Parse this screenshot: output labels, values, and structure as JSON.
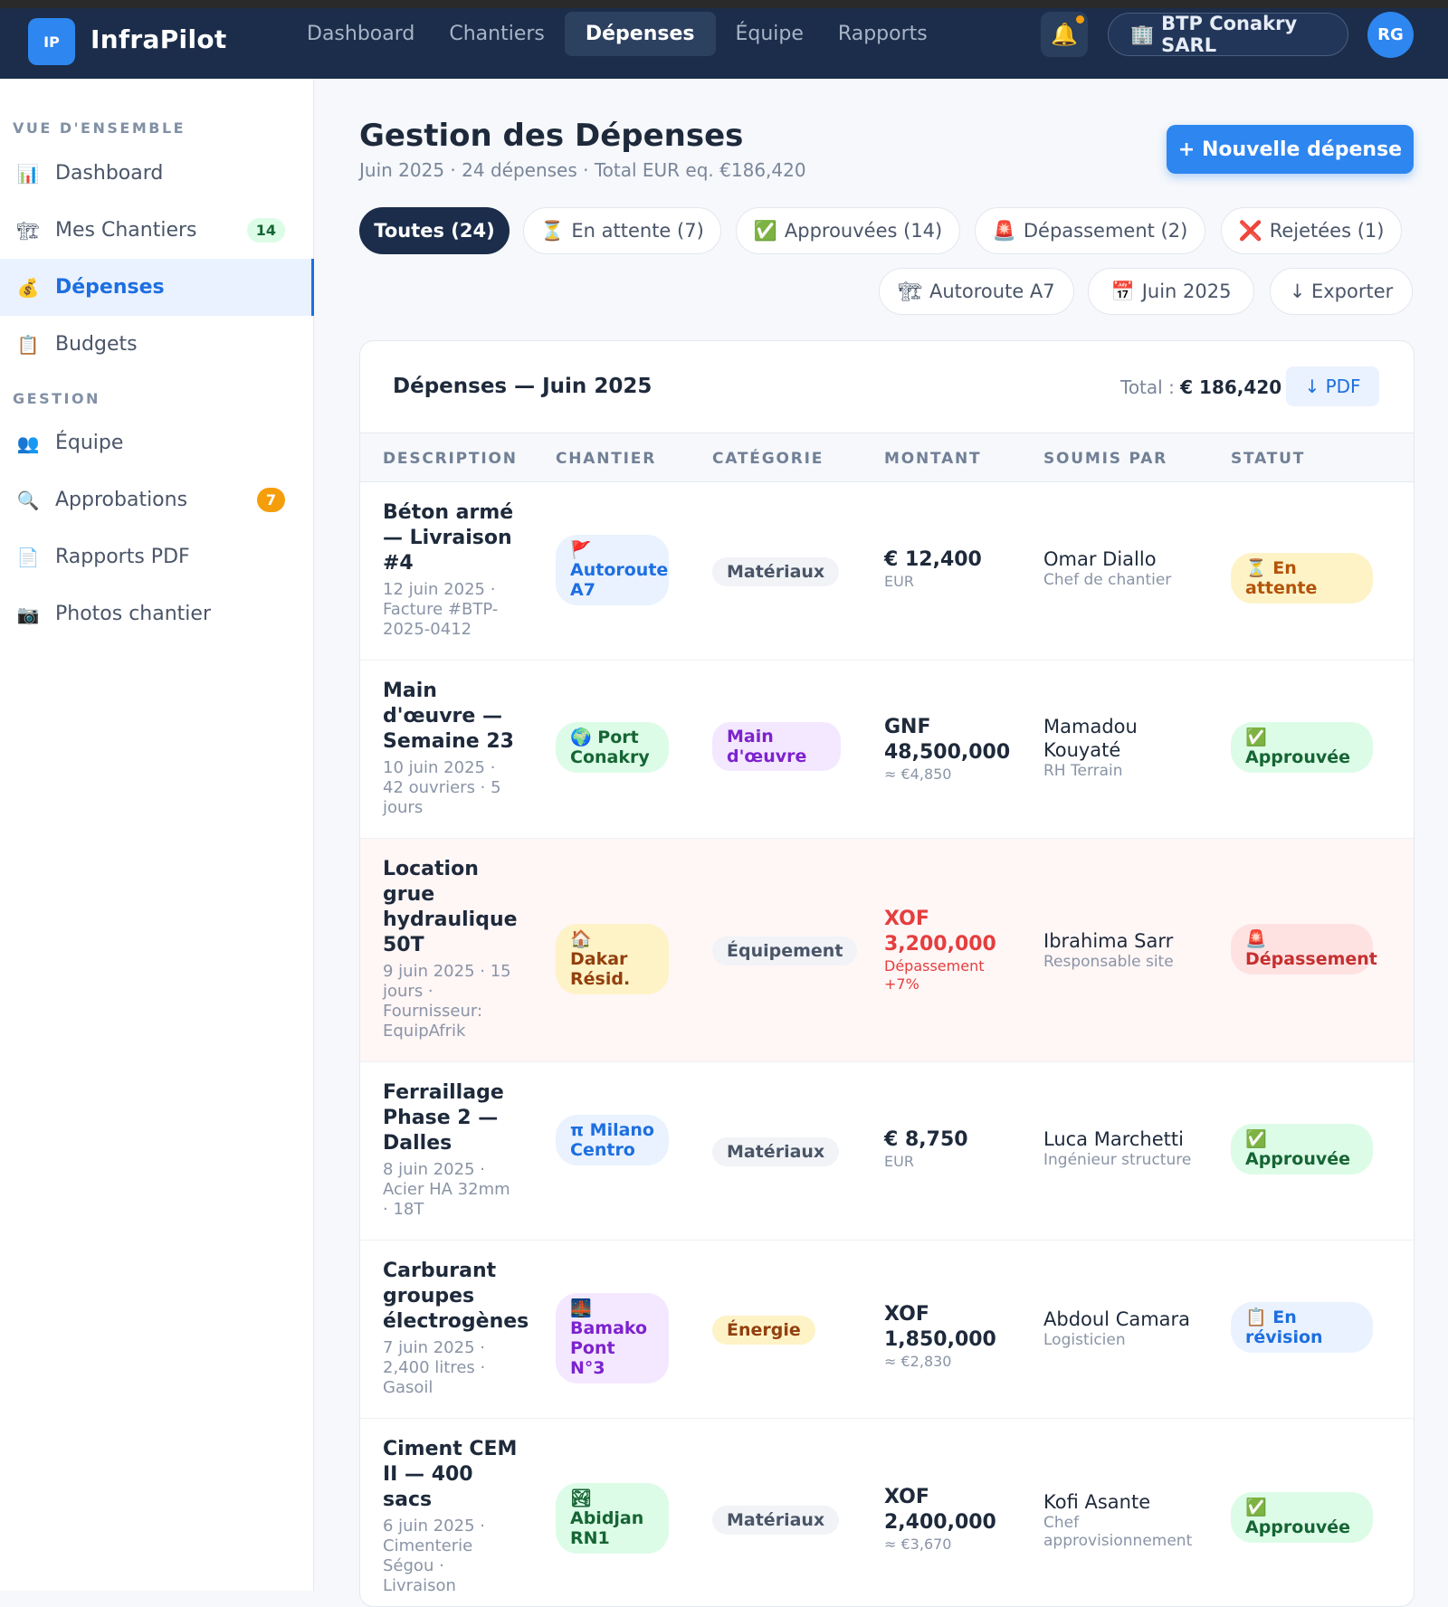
{
  "topbar": {
    "logo_text": "IP",
    "brand": "InfraPilot",
    "nav": [
      "Dashboard",
      "Chantiers",
      "Dépenses",
      "Équipe",
      "Rapports"
    ],
    "active_nav": "Dépenses",
    "bell_icon": "🔔",
    "org_icon": "🏢",
    "org": "BTP Conakry SARL",
    "avatar": "RG"
  },
  "sidebar": {
    "section1": "VUE D'ENSEMBLE",
    "section2": "GESTION",
    "items": [
      {
        "icon": "📊",
        "label": "Dashboard"
      },
      {
        "icon": "🏗",
        "label": "Mes Chantiers",
        "badge": "14"
      },
      {
        "icon": "💰",
        "label": "Dépenses"
      },
      {
        "icon": "📋",
        "label": "Budgets"
      },
      {
        "icon": "👥",
        "label": "Équipe"
      },
      {
        "icon": "🔍",
        "label": "Approbations",
        "badge": "7"
      },
      {
        "icon": "📄",
        "label": "Rapports PDF"
      },
      {
        "icon": "📷",
        "label": "Photos chantier"
      }
    ]
  },
  "header": {
    "title": "Gestion des Dépenses",
    "subtitle": "Juin 2025 · 24 dépenses · Total EUR eq. €186,420",
    "new_button": "+ Nouvelle dépense"
  },
  "filters": {
    "all": "Toutes (24)",
    "pending": {
      "icon": "⏳",
      "label": "En attente (7)"
    },
    "approved": {
      "icon": "✅",
      "label": "Approuvées (14)"
    },
    "overrun": {
      "icon": "🚨",
      "label": "Dépassement (2)"
    },
    "rejected": {
      "icon": "❌",
      "label": "Rejetées (1)"
    },
    "site": {
      "icon": "🏗",
      "label": "Autoroute A7"
    },
    "month": {
      "icon": "📅",
      "label": "Juin 2025"
    },
    "export": "↓ Exporter"
  },
  "table": {
    "title": "Dépenses — Juin 2025",
    "total_label": "Total :",
    "total_value": "€ 186,420",
    "pdf_button": "↓ PDF",
    "headers": [
      "DESCRIPTION",
      "CHANTIER",
      "CATÉGORIE",
      "MONTANT",
      "SOUMIS PAR",
      "STATUT"
    ],
    "rows": [
      {
        "title": "Béton armé — Livraison #4",
        "meta": "12 juin 2025 · Facture #BTP-2025-0412",
        "site_icon": "🚩",
        "site": "Autoroute A7",
        "category": "Matériaux",
        "amount": "€ 12,400",
        "amount_sub": "EUR",
        "submitter": "Omar Diallo",
        "role": "Chef de chantier",
        "status_icon": "⏳",
        "status": "En attente"
      },
      {
        "title": "Main d'œuvre — Semaine 23",
        "meta": "10 juin 2025 · 42 ouvriers · 5 jours",
        "site_icon": "🌍",
        "site": "Port Conakry",
        "category": "Main d'œuvre",
        "amount": "GNF 48,500,000",
        "amount_sub": "≈ €4,850",
        "submitter": "Mamadou Kouyaté",
        "role": "RH Terrain",
        "status_icon": "✅",
        "status": "Approuvée"
      },
      {
        "title": "Location grue hydraulique 50T",
        "meta": "9 juin 2025 · 15 jours · Fournisseur: EquipAfrik",
        "site_icon": "🏠",
        "site": "Dakar Résid.",
        "category": "Équipement",
        "amount": "XOF 3,200,000",
        "amount_sub": "Dépassement +7%",
        "submitter": "Ibrahima Sarr",
        "role": "Responsable site",
        "status_icon": "🚨",
        "status": "Dépassement"
      },
      {
        "title": "Ferraillage Phase 2 — Dalles",
        "meta": "8 juin 2025 · Acier HA 32mm · 18T",
        "site_icon": "π",
        "site": "Milano Centro",
        "category": "Matériaux",
        "amount": "€ 8,750",
        "amount_sub": "EUR",
        "submitter": "Luca Marchetti",
        "role": "Ingénieur structure",
        "status_icon": "✅",
        "status": "Approuvée"
      },
      {
        "title": "Carburant groupes électrogènes",
        "meta": "7 juin 2025 · 2,400 litres · Gasoil",
        "site_icon": "🌉",
        "site": "Bamako Pont N°3",
        "category": "Énergie",
        "amount": "XOF 1,850,000",
        "amount_sub": "≈ €2,830",
        "submitter": "Abdoul Camara",
        "role": "Logisticien",
        "status_icon": "📋",
        "status": "En révision"
      },
      {
        "title": "Ciment CEM II — 400 sacs",
        "meta": "6 juin 2025 · Cimenterie Ségou · Livraison",
        "site_icon": "🏞",
        "site": "Abidjan RN1",
        "category": "Matériaux",
        "amount": "XOF 2,400,000",
        "amount_sub": "≈ €3,670",
        "submitter": "Kofi Asante",
        "role": "Chef approvisionnement",
        "status_icon": "✅",
        "status": "Approuvée"
      }
    ]
  },
  "colors": {
    "topbar": "#1b2d4a",
    "accent": "#2e86f0",
    "danger": "#e53e3e"
  }
}
